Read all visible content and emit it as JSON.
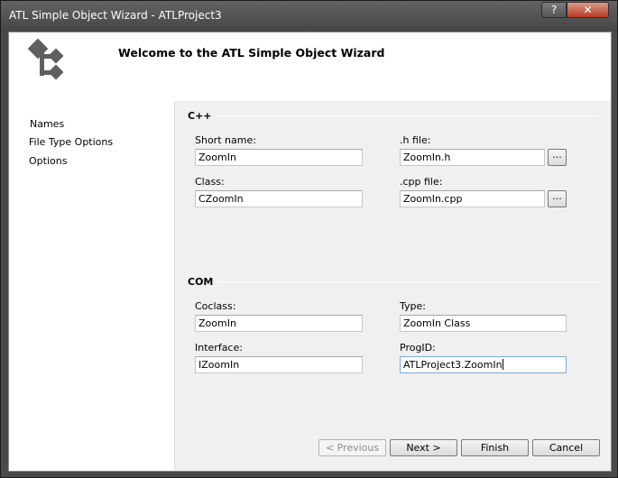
{
  "window": {
    "title": "ATL Simple Object Wizard - ATLProject3",
    "help_label": "?",
    "close_label": "✕"
  },
  "header": {
    "title": "Welcome to the ATL Simple Object Wizard",
    "logo_icon": "atl-wizard-icon"
  },
  "sidebar": {
    "items": [
      {
        "label": "Names"
      },
      {
        "label": "File Type Options"
      },
      {
        "label": "Options"
      }
    ]
  },
  "cpp": {
    "group_label": "C++",
    "short_name_label": "Short name:",
    "short_name_value": "ZoomIn",
    "h_file_label": ".h file:",
    "h_file_value": "ZoomIn.h",
    "class_label": "Class:",
    "class_value": "CZoomIn",
    "cpp_file_label": ".cpp file:",
    "cpp_file_value": "ZoomIn.cpp",
    "browse_label": "..."
  },
  "com": {
    "group_label": "COM",
    "coclass_label": "Coclass:",
    "coclass_value": "ZoomIn",
    "type_label": "Type:",
    "type_value": "ZoomIn Class",
    "interface_label": "Interface:",
    "interface_value": "IZoomIn",
    "progid_label": "ProgID:",
    "progid_value": "ATLProject3.ZoomIn"
  },
  "buttons": {
    "previous": "< Previous",
    "next": "Next >",
    "finish": "Finish",
    "cancel": "Cancel"
  },
  "colors": {
    "frame": "#4a4a4a",
    "panel": "#f0f0f0",
    "logo": "#5f5f5f",
    "close": "#c0402a"
  }
}
